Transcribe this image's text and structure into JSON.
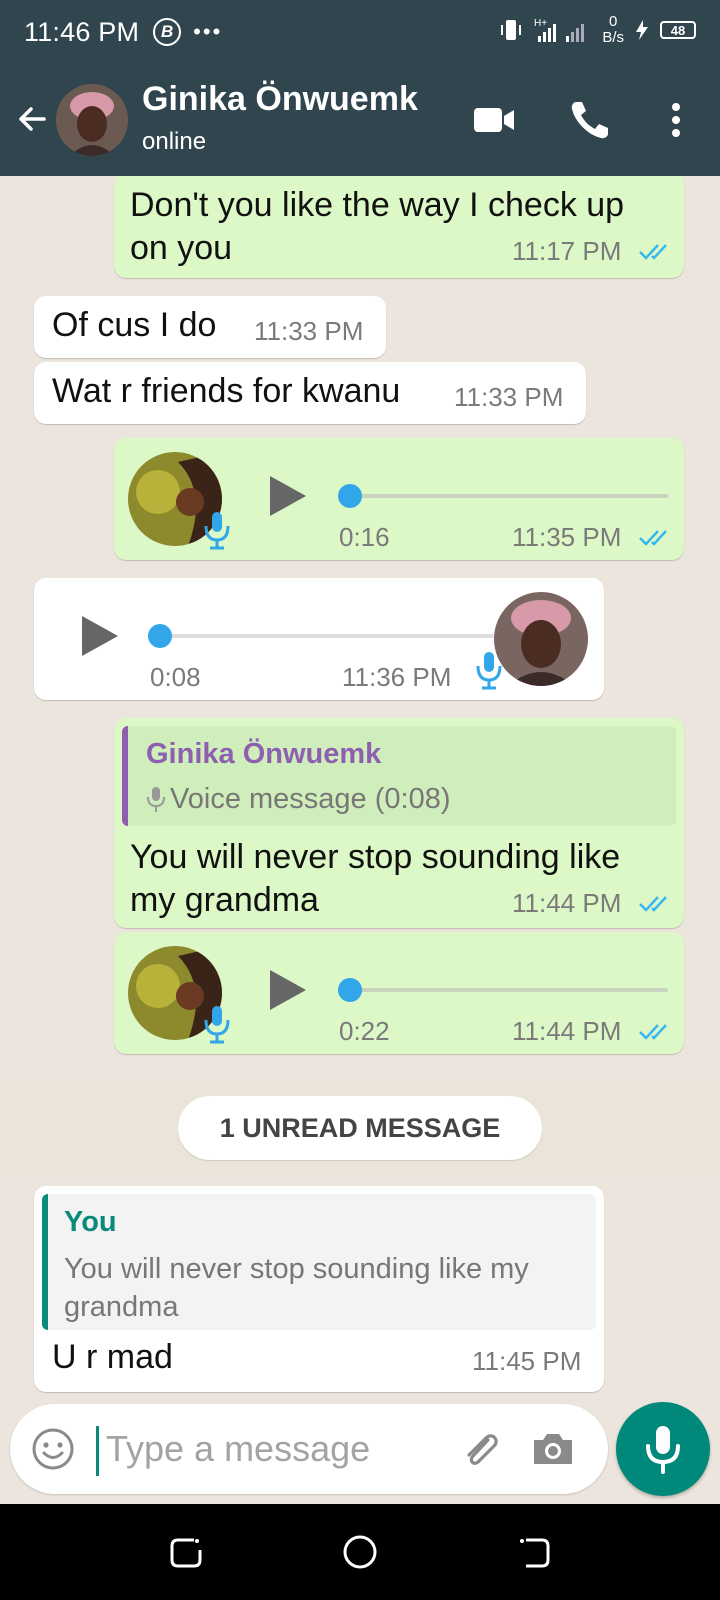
{
  "status_bar": {
    "time": "11:46 PM",
    "b_badge": "B",
    "dots": "•••",
    "net_speed_value": "0",
    "net_speed_unit": "B/s",
    "battery": "48"
  },
  "header": {
    "contact_name": "Ginika Önwuemk",
    "status": "online"
  },
  "messages": {
    "m1": {
      "text": "Don't you like the way I check up on you",
      "time": "11:17 PM"
    },
    "m2": {
      "text": "Of cus I do",
      "time": "11:33 PM"
    },
    "m3": {
      "text": "Wat r friends for kwanu",
      "time": "11:33 PM"
    },
    "v1": {
      "duration": "0:16",
      "time": "11:35 PM"
    },
    "v2": {
      "duration": "0:08",
      "time": "11:36 PM"
    },
    "m4": {
      "quote_name": "Ginika Önwuemk",
      "quote_text": "Voice message (0:08)",
      "text": "You will never stop sounding like my grandma",
      "time": "11:44 PM"
    },
    "v3": {
      "duration": "0:22",
      "time": "11:44 PM"
    },
    "unread": "1 UNREAD MESSAGE",
    "m5": {
      "quote_name": "You",
      "quote_text": "You will never stop sounding like my grandma",
      "text": "U r mad",
      "time": "11:45 PM"
    }
  },
  "input": {
    "placeholder": "Type a message"
  },
  "colors": {
    "header": "#31454f",
    "outgoing_bubble": "#dcf8c6",
    "incoming_bubble": "#ffffff",
    "accent": "#00897b",
    "read_ticks": "#34b7f1",
    "quote_name_purple": "#8e5fb0",
    "quote_name_teal": "#0a8a7a"
  },
  "icons": [
    "back-arrow-icon",
    "video-call-icon",
    "phone-icon",
    "more-options-icon",
    "play-icon",
    "mic-icon",
    "emoji-icon",
    "attach-icon",
    "camera-icon",
    "double-check-icon"
  ]
}
